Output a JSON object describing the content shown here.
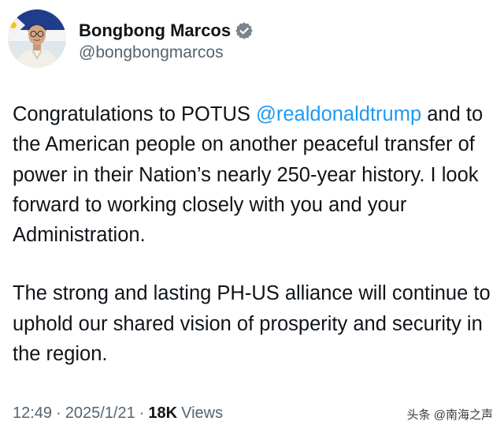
{
  "author": {
    "display_name": "Bongbong Marcos",
    "handle": "@bongbongmarcos",
    "verified_icon": "verified-badge-icon",
    "accent_color": "#1d9bf0"
  },
  "post": {
    "p1_before": "Congratulations to POTUS ",
    "mention": "@realdonaldtrump",
    "p1_after": " and to the American people on another peaceful transfer of power in their Nation’s nearly 250-year history. I look forward to working closely with you and your Administration.",
    "p2": "The strong and lasting PH-US alliance will continue to uphold our shared vision of prosperity and security in the region."
  },
  "meta": {
    "time": "12:49",
    "date": "2025/1/21",
    "views_count": "18K",
    "views_label": "Views",
    "separator": "·"
  },
  "watermark": "头条 @南海之声"
}
